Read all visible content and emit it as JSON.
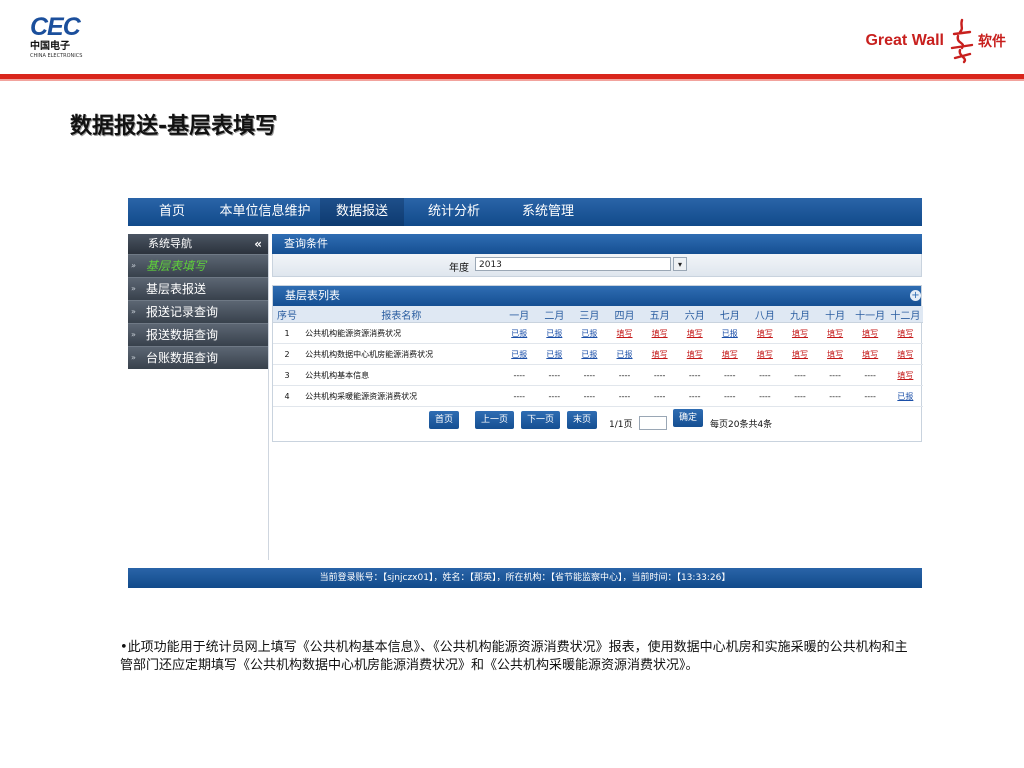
{
  "brand": {
    "left_logo_text": "CEC",
    "left_logo_cn": "中国电子",
    "left_logo_en": "CHINA ELECTRONICS",
    "right_logo_text": "Great Wall",
    "right_logo_suffix": "软件",
    "accent_color": "#d9261c"
  },
  "slide_title": "数据报送-基层表填写",
  "app": {
    "topnav": {
      "items": [
        {
          "label": "首页",
          "active": false
        },
        {
          "label": "本单位信息维护",
          "active": false
        },
        {
          "label": "数据报送",
          "active": true
        },
        {
          "label": "统计分析",
          "active": false
        },
        {
          "label": "系统管理",
          "active": false
        }
      ]
    },
    "sidebar": {
      "title": "系统导航",
      "collapse_label": "«",
      "items": [
        {
          "label": "基层表填写",
          "active": true
        },
        {
          "label": "基层表报送",
          "active": false
        },
        {
          "label": "报送记录查询",
          "active": false
        },
        {
          "label": "报送数据查询",
          "active": false
        },
        {
          "label": "台账数据查询",
          "active": false
        }
      ]
    },
    "query": {
      "title": "查询条件",
      "year_label": "年度",
      "year_value": "2013"
    },
    "list": {
      "title": "基层表列表",
      "columns": [
        "序号",
        "报表名称",
        "一月",
        "二月",
        "三月",
        "四月",
        "五月",
        "六月",
        "七月",
        "八月",
        "九月",
        "十月",
        "十一月",
        "十二月"
      ],
      "rows": [
        {
          "no": "1",
          "name": "公共机构能源资源消费状况",
          "months": [
            "已报",
            "已报",
            "已报",
            "填写",
            "填写",
            "填写",
            "已报",
            "填写",
            "填写",
            "填写",
            "填写",
            "填写"
          ]
        },
        {
          "no": "2",
          "name": "公共机构数据中心机房能源消费状况",
          "months": [
            "已报",
            "已报",
            "已报",
            "已报",
            "填写",
            "填写",
            "填写",
            "填写",
            "填写",
            "填写",
            "填写",
            "填写"
          ]
        },
        {
          "no": "3",
          "name": "公共机构基本信息",
          "months": [
            "----",
            "----",
            "----",
            "----",
            "----",
            "----",
            "----",
            "----",
            "----",
            "----",
            "----",
            "填写"
          ]
        },
        {
          "no": "4",
          "name": "公共机构采暖能源资源消费状况",
          "months": [
            "----",
            "----",
            "----",
            "----",
            "----",
            "----",
            "----",
            "----",
            "----",
            "----",
            "----",
            "已报"
          ]
        }
      ],
      "done_color": "#1b4fa8",
      "todo_color": "#c41818"
    },
    "pager": {
      "first": "首页",
      "prev": "上一页",
      "next": "下一页",
      "last": "末页",
      "page_info": "1/1页",
      "confirm": "确定",
      "summary": "每页20条共4条"
    },
    "status": "当前登录账号：【sjnjczx01】，姓名：【那英】，所在机构：【省节能监察中心】，当前时间：【13:33:26】"
  },
  "description": "•此项功能用于统计员网上填写《公共机构基本信息》、《公共机构能源资源消费状况》报表，使用数据中心机房和实施采暖的公共机构和主管部门还应定期填写《公共机构数据中心机房能源消费状况》和《公共机构采暖能源资源消费状况》。"
}
